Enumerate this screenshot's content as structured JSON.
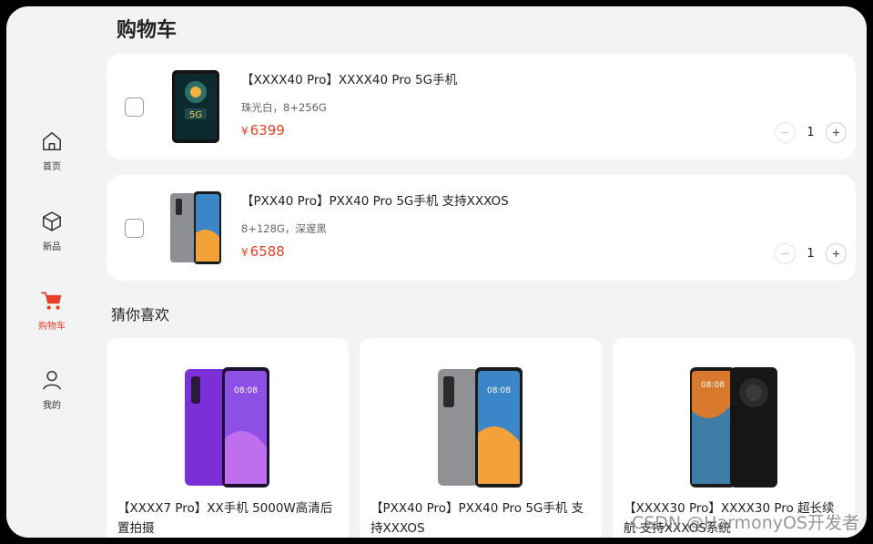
{
  "page": {
    "title": "购物车"
  },
  "nav": {
    "items": [
      {
        "label": "首页",
        "icon": "home-icon",
        "active": false
      },
      {
        "label": "新品",
        "icon": "cube-icon",
        "active": false
      },
      {
        "label": "购物车",
        "icon": "cart-icon",
        "active": true
      },
      {
        "label": "我的",
        "icon": "user-icon",
        "active": false
      }
    ]
  },
  "cart": {
    "currency": "¥",
    "items": [
      {
        "title": "【XXXX40 Pro】XXXX40 Pro 5G手机",
        "spec": "珠光白，8+256G",
        "price": "6399",
        "quantity": "1",
        "checked": false
      },
      {
        "title": "【PXX40 Pro】PXX40 Pro 5G手机 支持XXXOS",
        "spec": "8+128G，深邃黑",
        "price": "6588",
        "quantity": "1",
        "checked": false
      }
    ]
  },
  "recommend": {
    "title": "猜你喜欢",
    "items": [
      {
        "title": "【XXXX7 Pro】XX手机 5000W高清后置拍摄"
      },
      {
        "title": "【PXX40 Pro】PXX40 Pro 5G手机 支持XXXOS"
      },
      {
        "title": "【XXXX30 Pro】XXXX30 Pro 超长续航 支持XXXOS系统"
      }
    ]
  },
  "watermark": "CSDN @HarmonyOS开发者",
  "colors": {
    "accent": "#e84026",
    "background": "#f1f3f5",
    "card": "#ffffff"
  }
}
